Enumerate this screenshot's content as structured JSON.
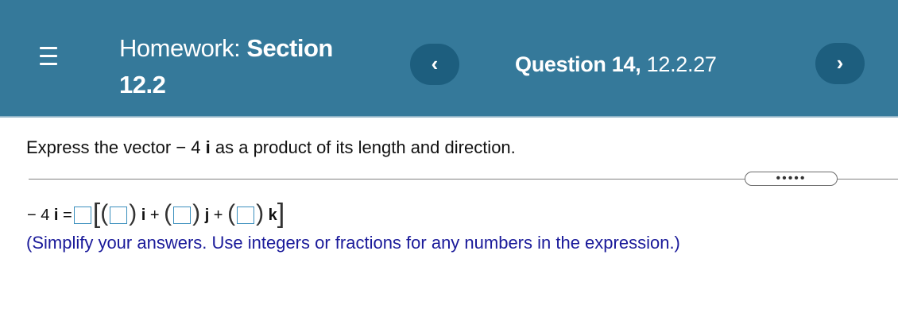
{
  "header": {
    "homework_prefix": "Homework: ",
    "homework_section_bold": "Section",
    "homework_section_num": "12.2",
    "question_bold": "Question 14,",
    "question_id": " 12.2.27",
    "prev_icon": "‹",
    "next_icon": "›"
  },
  "question": {
    "prompt_before": "Express the vector ",
    "prompt_vector_coef": "− 4",
    "prompt_vector_unit": "i",
    "prompt_after": " as a product of its length and direction.",
    "more_label": "•••••"
  },
  "answer": {
    "lhs_coef": "− 4",
    "lhs_unit": "i",
    "equals": " =",
    "plus": " +",
    "unit_i": "i",
    "unit_j": "j",
    "unit_k": "k",
    "hint": "(Simplify your answers. Use integers or fractions for any numbers in the expression.)"
  },
  "colors": {
    "header_bg": "#35799a",
    "nav_button_bg": "#1d5e7e",
    "hint_text": "#1a1a9a",
    "input_border": "#3b8fbd"
  }
}
